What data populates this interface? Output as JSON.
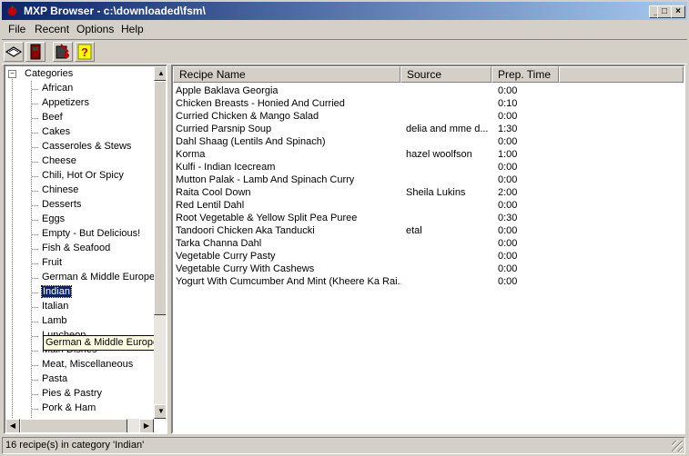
{
  "window": {
    "title": "MXP Browser - c:\\downloaded\\fsm\\"
  },
  "menu": [
    "File",
    "Recent",
    "Options",
    "Help"
  ],
  "toolbar": {
    "buttons": [
      "open-book-icon",
      "recipe-box-icon",
      "cookbook-icon",
      "help-icon"
    ]
  },
  "tree": {
    "root": "Categories",
    "items": [
      "African",
      "Appetizers",
      "Beef",
      "Cakes",
      "Casseroles & Stews",
      "Cheese",
      "Chili, Hot Or Spicy",
      "Chinese",
      "Desserts",
      "Eggs",
      "Empty - But Delicious!",
      "Fish & Seafood",
      "Fruit",
      "German & Middle European",
      "Indian",
      "Italian",
      "Lamb",
      "Luncheon",
      "Main Dishes",
      "Meat, Miscellaneous",
      "Pasta",
      "Pies & Pastry",
      "Pork & Ham"
    ],
    "selected": "Indian",
    "tooltip": "German & Middle European"
  },
  "list": {
    "columns": [
      "Recipe Name",
      "Source",
      "Prep. Time"
    ],
    "rows": [
      {
        "name": "Apple Baklava Georgia",
        "source": "",
        "time": "0:00"
      },
      {
        "name": "Chicken Breasts - Honied And Curried",
        "source": "",
        "time": "0:10"
      },
      {
        "name": "Curried Chicken & Mango Salad",
        "source": "",
        "time": "0:00"
      },
      {
        "name": "Curried Parsnip Soup",
        "source": "delia and mme d...",
        "time": "1:30"
      },
      {
        "name": "Dahl Shaag (Lentils And Spinach)",
        "source": "",
        "time": "0:00"
      },
      {
        "name": "Korma",
        "source": "hazel woolfson",
        "time": "1:00"
      },
      {
        "name": "Kulfi - Indian Icecream",
        "source": "",
        "time": "0:00"
      },
      {
        "name": "Mutton Palak - Lamb And Spinach Curry",
        "source": "",
        "time": "0:00"
      },
      {
        "name": "Raita Cool Down",
        "source": "Sheila Lukins",
        "time": "2:00"
      },
      {
        "name": "Red Lentil Dahl",
        "source": "",
        "time": "0:00"
      },
      {
        "name": "Root Vegetable & Yellow Split Pea Puree",
        "source": "",
        "time": "0:30"
      },
      {
        "name": "Tandoori Chicken Aka Tanducki",
        "source": "etal",
        "time": "0:00"
      },
      {
        "name": "Tarka Channa Dahl",
        "source": "",
        "time": "0:00"
      },
      {
        "name": "Vegetable Curry Pasty",
        "source": "",
        "time": "0:00"
      },
      {
        "name": "Vegetable Curry With Cashews",
        "source": "",
        "time": "0:00"
      },
      {
        "name": "Yogurt With Cumcumber And Mint (Kheere Ka Rai...",
        "source": "",
        "time": "0:00"
      }
    ]
  },
  "status": {
    "text": "16 recipe(s) in category 'Indian'"
  },
  "colors": {
    "titlebar": "#0a246a",
    "selection": "#0a246a",
    "tooltip": "#ffffe1"
  }
}
